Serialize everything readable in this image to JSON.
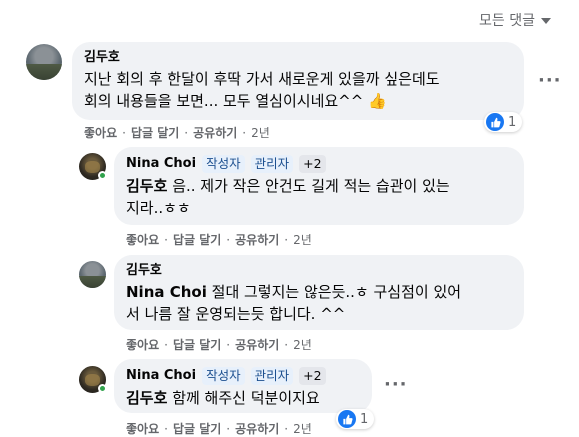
{
  "sort": {
    "label": "모든 댓글"
  },
  "comments": [
    {
      "author": "김두호",
      "lines": [
        "지난 회의 후 한달이 후딱 가서 새로운게 있을까 싶은데도",
        "회의 내용들을 보면... 모두 열심이시네요^^"
      ],
      "emoji": "👍",
      "actions": {
        "like": "좋아요",
        "reply": "답글 달기",
        "share": "공유하기",
        "time": "2년"
      },
      "reaction_count": "1"
    },
    {
      "author": "Nina Choi",
      "badges": [
        "작성자",
        "관리자",
        "+2"
      ],
      "mention": "김두호",
      "lines": [
        "음.. 제가 작은 안건도 길게 적는 습관이 있는",
        "지라..ㅎㅎ"
      ],
      "actions": {
        "like": "좋아요",
        "reply": "답글 달기",
        "share": "공유하기",
        "time": "2년"
      }
    },
    {
      "author": "김두호",
      "mention": "Nina Choi",
      "lines": [
        "절대 그렇지는 않은듯..ㅎ 구심점이 있어",
        "서 나름 잘 운영되는듯 합니다. ^^"
      ],
      "actions": {
        "like": "좋아요",
        "reply": "답글 달기",
        "share": "공유하기",
        "time": "2년"
      }
    },
    {
      "author": "Nina Choi",
      "badges": [
        "작성자",
        "관리자",
        "+2"
      ],
      "mention": "김두호",
      "lines": [
        "함께 해주신 덕분이지요"
      ],
      "actions": {
        "like": "좋아요",
        "reply": "답글 달기",
        "share": "공유하기",
        "time": "2년"
      },
      "reaction_count": "1"
    }
  ]
}
